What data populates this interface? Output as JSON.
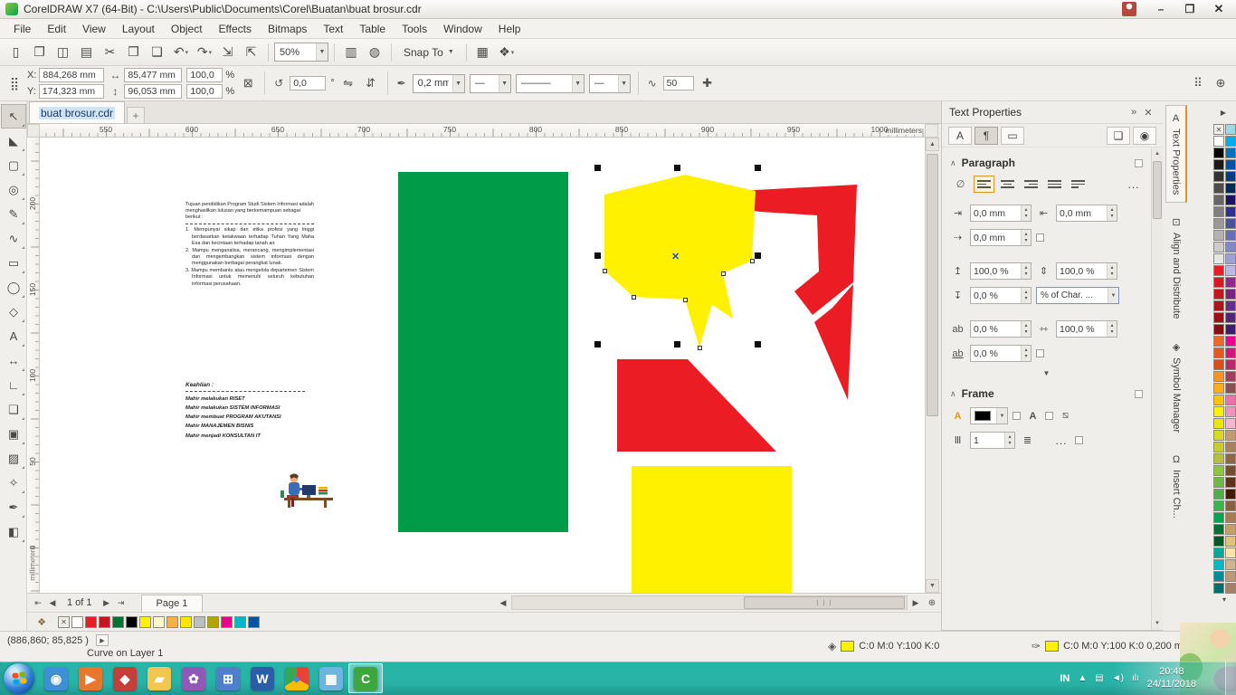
{
  "titlebar": {
    "title": "CorelDRAW X7 (64-Bit) - C:\\Users\\Public\\Documents\\Corel\\Buatan\\buat brosur.cdr"
  },
  "window_controls": {
    "minimize": "–",
    "maximize": "❐",
    "close": "✕"
  },
  "menu": {
    "items": [
      "File",
      "Edit",
      "View",
      "Layout",
      "Object",
      "Effects",
      "Bitmaps",
      "Text",
      "Table",
      "Tools",
      "Window",
      "Help"
    ]
  },
  "toolbar": {
    "icons": [
      {
        "g": "▯",
        "n": "new-document-icon"
      },
      {
        "g": "❐",
        "n": "open-icon"
      },
      {
        "g": "◫",
        "n": "save-icon"
      },
      {
        "g": "▤",
        "n": "print-icon"
      },
      {
        "g": "✂",
        "n": "cut-icon"
      },
      {
        "g": "❒",
        "n": "copy-icon"
      },
      {
        "g": "❑",
        "n": "paste-icon"
      },
      {
        "g": "↶",
        "n": "undo-icon",
        "dd": "▾"
      },
      {
        "g": "↷",
        "n": "redo-icon",
        "dd": "▾"
      },
      {
        "g": "⇲",
        "n": "import-icon"
      },
      {
        "g": "⇱",
        "n": "export-icon"
      }
    ],
    "zoom_level": "50%",
    "icons_mid": [
      {
        "g": "▥",
        "n": "fullscreen-preview-icon"
      },
      {
        "g": "◍",
        "n": "view-mode-icon"
      }
    ],
    "snap_label": "Snap To",
    "icons_end": [
      {
        "g": "▦",
        "n": "options-icon"
      },
      {
        "g": "❖",
        "n": "application-launcher-icon",
        "dd": "▾"
      }
    ]
  },
  "propbar": {
    "position_icon": "⣿",
    "x_label": "X:",
    "x_value": "884,268 mm",
    "y_label": "Y:",
    "y_value": "174,323 mm",
    "width_value": "85,477 mm",
    "height_value": "96,053 mm",
    "scale_x": "100,0",
    "scale_y": "100,0",
    "percent": "%",
    "angle_value": "0,0",
    "degree": "°",
    "outline_value": "0,2 mm",
    "line_start": "—",
    "line_style": "———",
    "line_end": "—",
    "smooth_value": "50"
  },
  "doc_tab": {
    "label": "buat brosur.cdr",
    "new_tab": "+"
  },
  "rulers": {
    "h_ticks": [
      "550",
      "600",
      "650",
      "700",
      "750",
      "800",
      "850",
      "900",
      "950",
      "1000"
    ],
    "v_ticks": [
      "200",
      "150",
      "100",
      "50",
      "0"
    ],
    "unit": "millimeters"
  },
  "toolbox": {
    "tools": [
      {
        "g": "↖",
        "n": "pick-tool",
        "cls": "active"
      },
      {
        "g": "◣",
        "n": "shape-tool"
      },
      {
        "g": "▢",
        "n": "crop-tool"
      },
      {
        "g": "◎",
        "n": "zoom-tool"
      },
      {
        "g": "✎",
        "n": "freehand-tool"
      },
      {
        "g": "∿",
        "n": "artistic-media-tool"
      },
      {
        "g": "▭",
        "n": "rectangle-tool"
      },
      {
        "g": "◯",
        "n": "ellipse-tool"
      },
      {
        "g": "◇",
        "n": "polygon-tool"
      },
      {
        "g": "A",
        "n": "text-tool"
      },
      {
        "g": "↔",
        "n": "dimension-tool"
      },
      {
        "g": "∟",
        "n": "connector-tool"
      },
      {
        "g": "❏",
        "n": "drop-shadow-tool"
      },
      {
        "g": "▣",
        "n": "contour-tool"
      },
      {
        "g": "▨",
        "n": "transparency-tool"
      },
      {
        "g": "✧",
        "n": "color-eyedropper-tool"
      },
      {
        "g": "✒",
        "n": "outline-pen-tool"
      },
      {
        "g": "◧",
        "n": "interactive-fill-tool"
      }
    ]
  },
  "canvas": {
    "colors": {
      "green": "#009B48",
      "yellow": "#FFF100",
      "red": "#EC1C24"
    },
    "intro": "Tujuan pendidikan Program Studi Sistem Informasi adalah menghasilkan lulusan yang berkemampuan sebagai berikut :",
    "items": [
      "1. Mempunyai sikap dan etika profesi yang tinggi berdasarkan ketakwaan terhadap Tuhan Yang Maha Esa dan kecintaan terhadap tanah air.",
      "2. Mampu menganalisa, merancang, mengimplementasi dan mengembangkan sistem informasi dengan menggunakan berbagai perangkat lunak.",
      "3. Mampu membantu atau mengelola departemen Sistem Informasi untuk memenuhi seluruh kebutuhan informasi perusahaan."
    ],
    "keahlian_title": "Keahlian :",
    "skills": [
      "Mahir melakukan RISET",
      "Mahir melakukan SISTEM INFORMASI",
      "Mahir membuat PROGRAM AKUTANSI",
      "Mahir MANAJEMEN BISNIS",
      "Mahir menjadi KONSULTAN IT"
    ]
  },
  "docker": {
    "title": "Text Properties",
    "float_icon": "»",
    "close_icon": "✕",
    "header_icons": [
      {
        "g": "A",
        "n": "character-props-button"
      },
      {
        "g": "¶",
        "n": "paragraph-props-button",
        "cls": "active"
      },
      {
        "g": "▭",
        "n": "frame-props-button"
      }
    ],
    "header_right": [
      {
        "g": "❏",
        "n": "copy-text-properties-button"
      },
      {
        "g": "◉",
        "n": "text-eyedropper-button"
      }
    ],
    "paragraph": {
      "title": "Paragraph",
      "align_icons": [
        {
          "n": "align-none-icon",
          "cls": "none"
        },
        {
          "n": "align-left-icon",
          "cls": "active"
        },
        {
          "n": "align-center-icon"
        },
        {
          "n": "align-right-icon"
        },
        {
          "n": "align-full-justify-icon"
        },
        {
          "n": "align-force-justify-icon"
        }
      ],
      "more": "...",
      "indent_left": "0,0 mm",
      "indent_right": "0,0 mm",
      "indent_first": "0,0 mm",
      "spacing_before": "100,0 %",
      "spacing_line": "100,0 %",
      "spacing_after": "0,0 %",
      "spacing_unit": "% of Char. ...",
      "word_spacing": "0,0 %",
      "char_spacing": "100,0 %",
      "language_spacing": "0,0 %",
      "expand": "▼"
    },
    "frame": {
      "title": "Frame",
      "columns": "1",
      "more": "..."
    }
  },
  "side_tabs": [
    {
      "label": "Text Properties",
      "g": "A",
      "n": "tab-text-properties",
      "cls": "active"
    },
    {
      "label": "Align and Distribute",
      "g": "⊡",
      "n": "tab-align-and-distribute"
    },
    {
      "label": "Symbol Manager",
      "g": "◈",
      "n": "tab-symbol-manager"
    },
    {
      "label": "Insert Ch...",
      "g": "Ω",
      "n": "tab-insert-character"
    }
  ],
  "palette": {
    "expand": "▶",
    "scroll_down": "▾",
    "colors": [
      "none",
      "#9ADBE8",
      "#FFFFFF",
      "#00AEEF",
      "#000000",
      "#0072BC",
      "#1A1A1A",
      "#0054A6",
      "#333333",
      "#003F87",
      "#4D4D4D",
      "#002B5C",
      "#666666",
      "#1B1464",
      "#808080",
      "#2E3192",
      "#999999",
      "#4A51A3",
      "#B3B3B3",
      "#666FB4",
      "#CCCCCC",
      "#8287C5",
      "#E6E6E6",
      "#9EA0D6",
      "#ED1C24",
      "#BBB8E7",
      "#D91920",
      "#92278F",
      "#C4161C",
      "#7B2382",
      "#B01318",
      "#662D91",
      "#9C1014",
      "#52247F",
      "#880D10",
      "#3D1D6D",
      "#F26522",
      "#EC008C",
      "#E55A1E",
      "#D4147E",
      "#D84F1A",
      "#BC2870",
      "#F7941D",
      "#A43C62",
      "#FBAF17",
      "#8C5054",
      "#FFC20E",
      "#F06EA9",
      "#FFF200",
      "#F491BE",
      "#EDE511",
      "#F8B4D3",
      "#DBD822",
      "#C49A6C",
      "#C9CB33",
      "#AB8057",
      "#B7BE44",
      "#926642",
      "#8DC63F",
      "#794C2D",
      "#6FBA44",
      "#603318",
      "#51AE49",
      "#471903",
      "#39B54A",
      "#8B5E3C",
      "#00A651",
      "#A97C50",
      "#007236",
      "#C79F64",
      "#005826",
      "#E5C178",
      "#00A99D",
      "#FFE3A6",
      "#00B7C6",
      "#D2B48C",
      "#008C99",
      "#BC9A78",
      "#006F71",
      "#A68064"
    ]
  },
  "navigator": {
    "icons": {
      "first": "⇤",
      "prev": "◀",
      "next": "▶",
      "last": "⇥",
      "zoom": "⊕"
    },
    "page_info": "1 of 1",
    "page_tab": "Page 1"
  },
  "doc_palette": {
    "icon": "❖",
    "colors": [
      "none",
      "#FFFFFF",
      "#ED1C24",
      "#C4161C",
      "#007236",
      "#000000",
      "#FFF200",
      "#FFFAC8",
      "#FBB040",
      "#FFE600",
      "#BCBEC0",
      "#B5A300",
      "#EC008C",
      "#00B7C6",
      "#0054A6"
    ]
  },
  "statusbar": {
    "coords": "(886,860; 85,825 )",
    "details_icon": "▶",
    "object_info": "Curve on Layer 1",
    "fill_icon": "◈",
    "fill_value": "C:0 M:0 Y:100 K:0",
    "outline_icon": "✑",
    "outline_value": "C:0 M:0 Y:100 K:0  0,200 mm"
  },
  "taskbar": {
    "lang": "IN",
    "time": "20:48",
    "date": "24/11/2018",
    "icons": [
      {
        "n": "messenger-icon",
        "bg": "#3f8fd6",
        "g": "◉"
      },
      {
        "n": "media-player-icon",
        "bg": "#e8762e",
        "g": "▶"
      },
      {
        "n": "red-app-icon",
        "bg": "#c43e3a",
        "g": "◆"
      },
      {
        "n": "folder-icon",
        "bg": "#f3c64f",
        "g": "▰"
      },
      {
        "n": "paint-icon",
        "bg": "#9059b8",
        "g": "✿"
      },
      {
        "n": "calculator-icon",
        "bg": "#4f7ecb",
        "g": "⊞"
      },
      {
        "n": "word-icon",
        "bg": "#2b5ea7",
        "g": "W"
      },
      {
        "n": "chrome-icon",
        "bg": "conic-gradient(#ea4335 0 33%, #fbbc05 33% 66%, #34a853 66% 100%)",
        "g": "●",
        "fg": "#4285f4"
      },
      {
        "n": "photo-viewer-icon",
        "bg": "#6fb3e0",
        "g": "▦"
      },
      {
        "n": "coreldraw-icon",
        "bg": "#3da63d",
        "g": "C",
        "cls": "active"
      }
    ],
    "tray_icons": [
      {
        "g": "▲",
        "n": "show-hidden-icons-button"
      },
      {
        "g": "▤",
        "n": "display-tray-icon"
      },
      {
        "g": "◄)",
        "n": "volume-tray-icon"
      },
      {
        "g": "ılı",
        "n": "network-tray-icon"
      }
    ]
  }
}
